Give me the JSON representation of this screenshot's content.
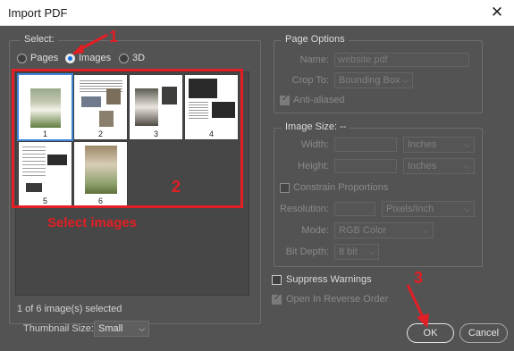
{
  "window": {
    "title": "Import PDF",
    "close_icon": "close-icon"
  },
  "select": {
    "group_title": "Select:",
    "options": [
      {
        "label": "Pages",
        "checked": false
      },
      {
        "label": "Images",
        "checked": true
      },
      {
        "label": "3D",
        "checked": false
      }
    ]
  },
  "thumbnails": [
    {
      "number": "1",
      "selected": true
    },
    {
      "number": "2",
      "selected": false
    },
    {
      "number": "3",
      "selected": false
    },
    {
      "number": "4",
      "selected": false
    },
    {
      "number": "5",
      "selected": false
    },
    {
      "number": "6",
      "selected": false
    }
  ],
  "status": {
    "selection_text": "1 of 6 image(s) selected"
  },
  "thumbnail_size": {
    "label": "Thumbnail Size:",
    "value": "Small"
  },
  "page_options": {
    "group_title": "Page Options",
    "name_label": "Name:",
    "name_value": "website.pdf",
    "crop_label": "Crop To:",
    "crop_value": "Bounding Box",
    "anti_aliased_label": "Anti-aliased"
  },
  "image_size": {
    "group_title": "Image Size: --",
    "width_label": "Width:",
    "width_unit": "Inches",
    "height_label": "Height:",
    "height_unit": "Inches",
    "constrain_label": "Constrain Proportions",
    "resolution_label": "Resolution:",
    "resolution_unit": "Pixels/Inch",
    "mode_label": "Mode:",
    "mode_value": "RGB Color",
    "bit_depth_label": "Bit Depth:",
    "bit_depth_value": "8 bit"
  },
  "options": {
    "suppress_warnings_label": "Suppress Warnings",
    "reverse_order_label": "Open In Reverse Order"
  },
  "buttons": {
    "ok_label": "OK",
    "cancel_label": "Cancel"
  },
  "annotations": {
    "step1": "1",
    "step2": "2",
    "step3": "3",
    "select_images_text": "Select images",
    "color": "#e31e24"
  },
  "colors": {
    "dialog_bg": "#535353",
    "accent": "#1473e6"
  }
}
